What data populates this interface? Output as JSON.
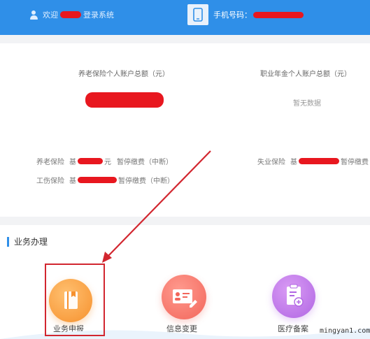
{
  "header": {
    "welcome_prefix": "欢迎",
    "welcome_suffix": "登录系统",
    "phone_label": "手机号码："
  },
  "account": {
    "pension_total_title": "养老保险个人账户总额（元）",
    "annuity_total_title": "职业年金个人账户总额（元）",
    "annuity_total_value": "暂无数据"
  },
  "insurance": {
    "pension": {
      "name": "养老保险",
      "prefix": "基",
      "unit": "元",
      "status": "暂停缴费（中断）"
    },
    "injury": {
      "name": "工伤保险",
      "prefix": "基",
      "status": "暂停缴费（中断）"
    },
    "unemployment": {
      "name": "失业保险",
      "prefix": "基",
      "status": "暂停缴费"
    }
  },
  "business": {
    "title": "业务办理",
    "items": [
      {
        "label": "业务申报",
        "icon": "book-icon"
      },
      {
        "label": "信息变更",
        "icon": "id-card-edit-icon"
      },
      {
        "label": "医疗备案",
        "icon": "clipboard-plus-icon"
      }
    ]
  },
  "watermark": "mingyan1.com",
  "colors": {
    "header": "#2f8fe8",
    "redaction": "#e8171f",
    "highlight": "#d2262f"
  }
}
